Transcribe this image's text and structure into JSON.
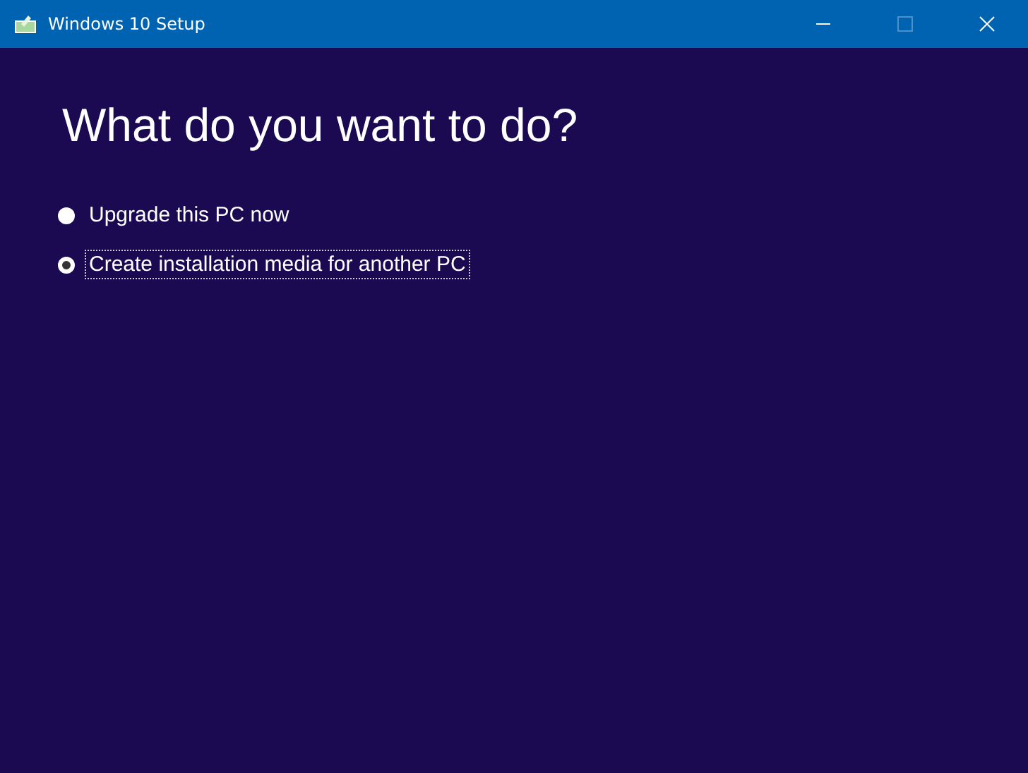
{
  "window": {
    "title": "Windows 10 Setup",
    "maximize_disabled": true
  },
  "heading": "What do you want to do?",
  "options": [
    {
      "label": "Upgrade this PC now",
      "selected": false,
      "focused": false
    },
    {
      "label": "Create installation media for another PC",
      "selected": true,
      "focused": true
    }
  ]
}
